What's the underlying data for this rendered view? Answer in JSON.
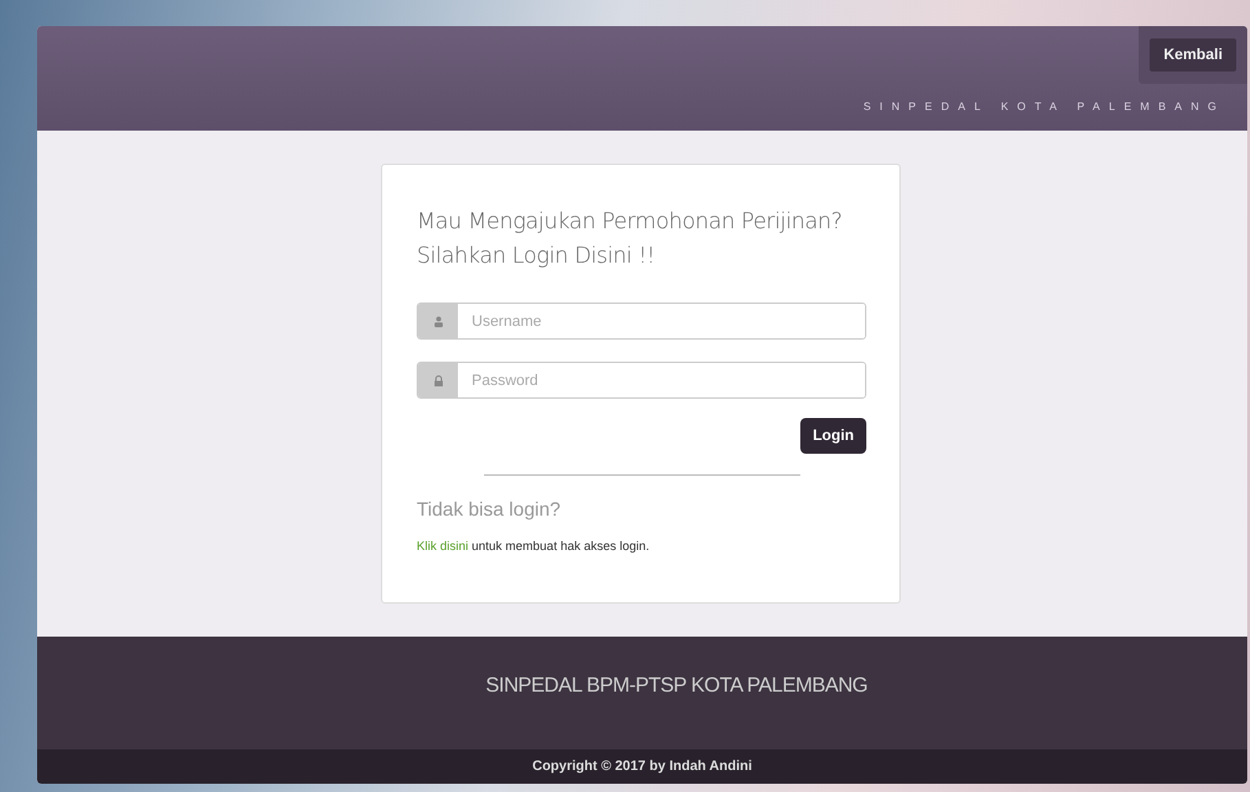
{
  "header": {
    "back_button": "Kembali",
    "site_title": "SINPEDAL KOTA PALEMBANG"
  },
  "login_card": {
    "heading_line_1": "Mau Mengajukan Permohonan Perijinan?",
    "heading_line_2": "Silahkan Login Disini !!",
    "fields": [
      {
        "kind": "user",
        "placeholder": "Username"
      },
      {
        "kind": "lock",
        "placeholder": "Password"
      }
    ],
    "login_button": "Login",
    "help_heading": "Tidak bisa login?",
    "help_link": "Klik disini",
    "help_text": "untuk membuat hak akses login."
  },
  "footer": {
    "title": "SINPEDAL BPM-PTSP KOTA PALEMBANG",
    "copyright": "Copyright © 2017 by Indah Andini"
  }
}
